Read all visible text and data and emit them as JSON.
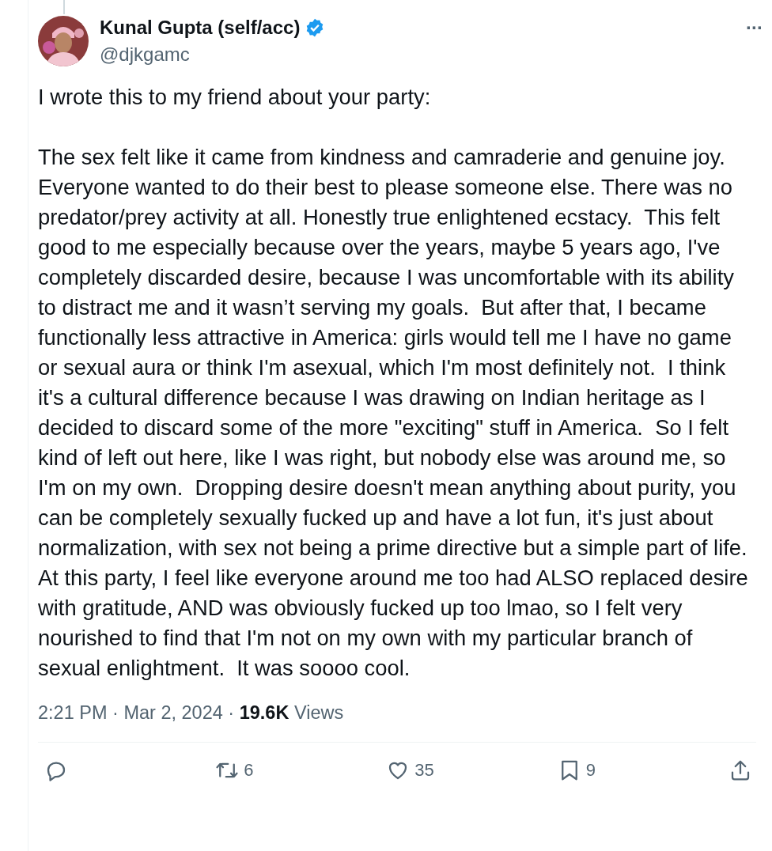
{
  "author": {
    "name": "Kunal Gupta (self/acc)",
    "verified": true,
    "handle": "@djkgamc"
  },
  "more": "···",
  "body": [
    "I wrote this to my friend about your party:",
    "The sex felt like it came from kindness and camraderie and genuine joy. Everyone wanted to do their best to please someone else. There was no predator/prey activity at all. Honestly true enlightened ecstacy.  This felt good to me especially because over the years, maybe 5 years ago, I've completely discarded desire, because I was uncomfortable with its ability to distract me and it wasn’t serving my goals.  But after that, I became functionally less attractive in America: girls would tell me I have no game or sexual aura or think I'm asexual, which I'm most definitely not.  I think it's a cultural difference because I was drawing on Indian heritage as I decided to discard some of the more \"exciting\" stuff in America.  So I felt kind of left out here, like I was right, but nobody else was around me, so I'm on my own.  Dropping desire doesn't mean anything about purity, you can be completely sexually fucked up and have a lot fun, it's just about normalization, with sex not being a prime directive but a simple part of life.  At this party, I feel like everyone around me too had ALSO replaced desire with gratitude, AND was obviously fucked up too lmao, so I felt very nourished to find that I'm not on my own with my particular branch of sexual enlightment.  It was soooo cool."
  ],
  "meta": "2:21 PM · Mar 2, 2024 · **19.6K** Views",
  "actions": [
    {
      "kind": "reply"
    },
    {
      "kind": "repost",
      "count": "6"
    },
    {
      "kind": "like",
      "count": "35"
    },
    {
      "kind": "bookmark",
      "count": "9"
    },
    {
      "kind": "share"
    }
  ]
}
